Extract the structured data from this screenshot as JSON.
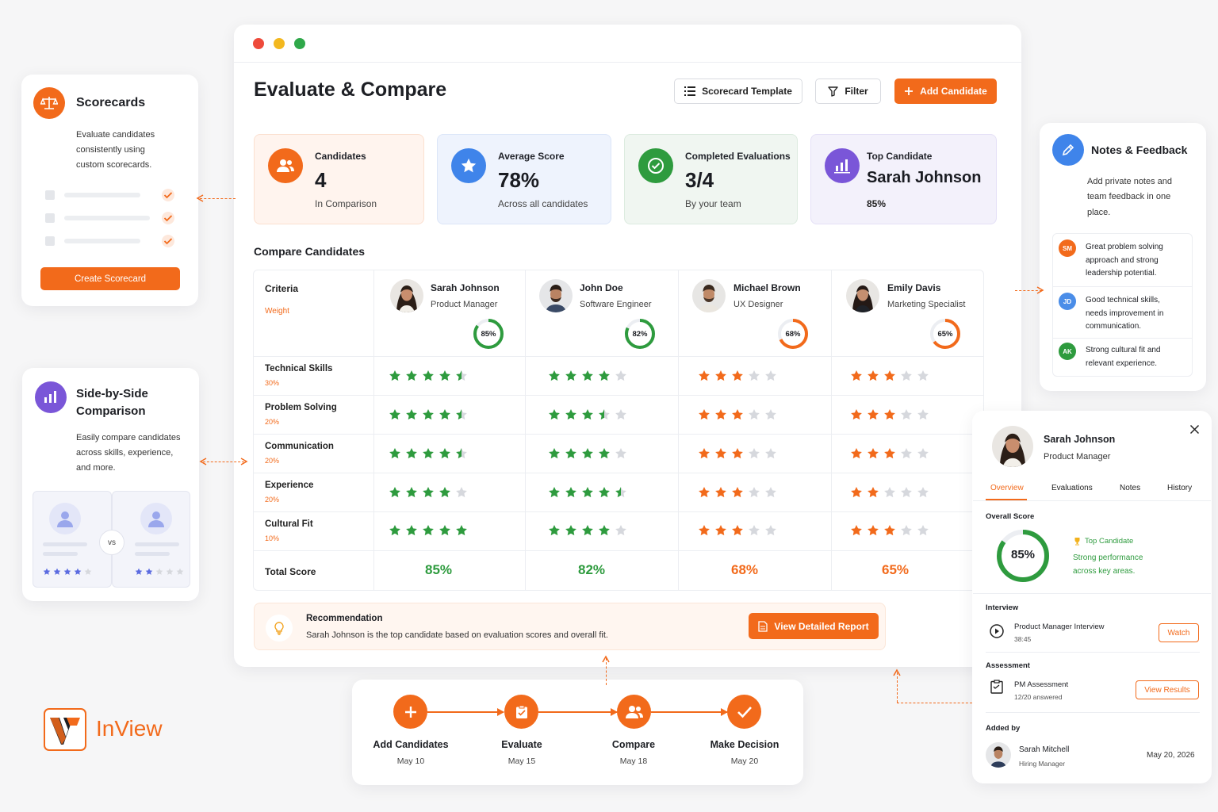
{
  "main_window": {
    "title": "Evaluate & Compare",
    "buttons": {
      "scorecard_template": "Scorecard Template",
      "filter": "Filter",
      "add_candidate": "Add Candidate"
    }
  },
  "stats": [
    {
      "label": "Candidates",
      "value": "4",
      "sub": "In Comparison",
      "icon": "users-icon"
    },
    {
      "label": "Average Score",
      "value": "78%",
      "sub": "Across all candidates",
      "icon": "star-icon"
    },
    {
      "label": "Completed Evaluations",
      "value": "3/4",
      "sub": "By your team",
      "icon": "check-icon"
    },
    {
      "label": "Top Candidate",
      "value": "Sarah Johnson",
      "sub": "85%",
      "icon": "chart-icon"
    }
  ],
  "compare": {
    "title": "Compare Candidates",
    "criteria_header": "Criteria",
    "weight_header": "Weight",
    "candidates": [
      {
        "name": "Sarah Johnson",
        "role": "Product Manager",
        "score": "85%",
        "score_value": 85,
        "color": "#2e9b3e"
      },
      {
        "name": "John Doe",
        "role": "Software Engineer",
        "score": "82%",
        "score_value": 82,
        "color": "#2e9b3e"
      },
      {
        "name": "Michael Brown",
        "role": "UX Designer",
        "score": "68%",
        "score_value": 68,
        "color": "#f26a1b"
      },
      {
        "name": "Emily Davis",
        "role": "Marketing Specialist",
        "score": "65%",
        "score_value": 65,
        "color": "#f26a1b"
      }
    ],
    "criteria": [
      {
        "name": "Technical Skills",
        "weight": "30%",
        "ratings": [
          4.5,
          4,
          3,
          3
        ]
      },
      {
        "name": "Problem Solving",
        "weight": "20%",
        "ratings": [
          4.5,
          3.5,
          3,
          3
        ]
      },
      {
        "name": "Communication",
        "weight": "20%",
        "ratings": [
          4.5,
          4,
          3,
          3
        ]
      },
      {
        "name": "Experience",
        "weight": "20%",
        "ratings": [
          4,
          4.5,
          3,
          2
        ]
      },
      {
        "name": "Cultural Fit",
        "weight": "10%",
        "ratings": [
          5,
          4,
          3,
          3
        ]
      }
    ],
    "total_label": "Total Score",
    "totals": [
      "85%",
      "82%",
      "68%",
      "65%"
    ]
  },
  "recommendation": {
    "title": "Recommendation",
    "text": "Sarah Johnson is the top candidate based on evaluation scores and overall fit.",
    "button": "View Detailed Report"
  },
  "scorecards_panel": {
    "title": "Scorecards",
    "desc_lines": [
      "Evaluate candidates",
      "consistently using",
      "custom scorecards."
    ],
    "button": "Create Scorecard"
  },
  "side_panel": {
    "title_lines": [
      "Side-by-Side",
      "Comparison"
    ],
    "desc_lines": [
      "Easily compare candidates",
      "across skills, experience,",
      "and more."
    ],
    "vs": "vs",
    "left_rating": 4,
    "right_rating": 2
  },
  "notes_panel": {
    "title": "Notes & Feedback",
    "desc_lines": [
      "Add private notes and",
      "team feedback in one",
      "place."
    ],
    "notes": [
      {
        "initials": "SM",
        "color": "#f26a1b",
        "lines": [
          "Great problem solving",
          "approach and strong",
          "leadership potential."
        ]
      },
      {
        "initials": "JD",
        "color": "#4a8de8",
        "lines": [
          "Good technical skills,",
          "needs improvement in",
          "communication."
        ]
      },
      {
        "initials": "AK",
        "color": "#2e9b3e",
        "lines": [
          "Strong cultural fit and",
          "relevant experience."
        ]
      }
    ]
  },
  "profile_panel": {
    "name": "Sarah Johnson",
    "role": "Product Manager",
    "tabs": [
      "Overview",
      "Evaluations",
      "Notes",
      "History"
    ],
    "active_tab": "Overview",
    "overall_label": "Overall Score",
    "overall_score": "85%",
    "overall_value": 85,
    "badge": "Top Candidate",
    "perf_lines": [
      "Strong performance",
      "across key areas."
    ],
    "interview_label": "Interview",
    "interview_title": "Product Manager Interview",
    "interview_duration": "38:45",
    "watch": "Watch",
    "assessment_label": "Assessment",
    "assessment_title": "PM Assessment",
    "assessment_progress": "12/20 answered",
    "view_results": "View Results",
    "added_by_label": "Added by",
    "added_by_name": "Sarah Mitchell",
    "added_by_role": "Hiring Manager",
    "added_date": "May 20, 2026"
  },
  "flow": [
    {
      "label": "Add Candidates",
      "date": "May 10",
      "icon": "plus-icon"
    },
    {
      "label": "Evaluate",
      "date": "May 15",
      "icon": "clipboard-icon"
    },
    {
      "label": "Compare",
      "date": "May 18",
      "icon": "users-icon"
    },
    {
      "label": "Make Decision",
      "date": "May 20",
      "icon": "check-icon"
    }
  ],
  "brand": {
    "name": "InView",
    "accent": "#f26a1b"
  }
}
